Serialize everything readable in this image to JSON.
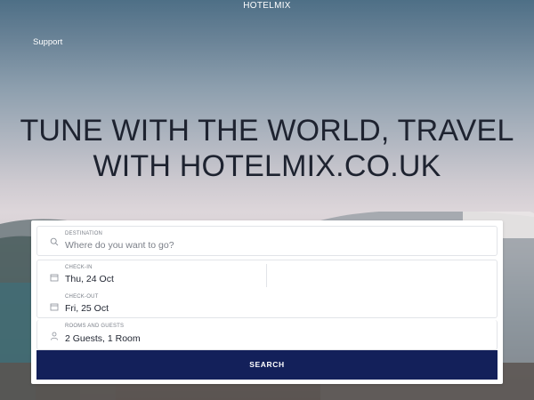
{
  "header": {
    "brand": "HOTELMIX",
    "support_link": "Support"
  },
  "hero": {
    "title_line1": "TUNE WITH THE WORLD, TRAVEL",
    "title_line2": "WITH HOTELMIX.CO.UK"
  },
  "search": {
    "destination": {
      "label": "DESTINATION",
      "placeholder": "Where do you want to go?",
      "icon": "search-icon"
    },
    "check_in": {
      "label": "CHECK-IN",
      "value": "Thu, 24 Oct",
      "icon": "calendar-icon"
    },
    "check_out": {
      "label": "CHECK-OUT",
      "value": "Fri, 25 Oct",
      "icon": "calendar-icon"
    },
    "rooms": {
      "label": "ROOMS AND GUESTS",
      "value": "2 Guests, 1 Room",
      "icon": "person-icon"
    },
    "submit_label": "SEARCH"
  },
  "colors": {
    "button_bg": "#13205a",
    "hero_text": "#1e2330"
  }
}
